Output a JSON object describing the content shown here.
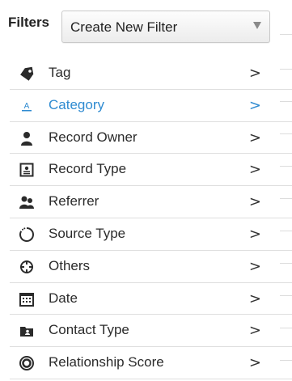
{
  "header": {
    "title": "Filters",
    "select": {
      "value": "Create New Filter"
    }
  },
  "filters": [
    {
      "label": "Tag",
      "icon": "tag-icon",
      "chevron": ">"
    },
    {
      "label": "Category",
      "icon": "category-icon",
      "chevron": ">",
      "active": true
    },
    {
      "label": "Record Owner",
      "icon": "person-icon",
      "chevron": ">"
    },
    {
      "label": "Record Type",
      "icon": "id-card-icon",
      "chevron": ">"
    },
    {
      "label": "Referrer",
      "icon": "referrer-icon",
      "chevron": ">"
    },
    {
      "label": "Source Type",
      "icon": "spinner-icon",
      "chevron": ">"
    },
    {
      "label": "Others",
      "icon": "crosshair-icon",
      "chevron": ">"
    },
    {
      "label": "Date",
      "icon": "calendar-icon",
      "chevron": ">"
    },
    {
      "label": "Contact Type",
      "icon": "contact-folder-icon",
      "chevron": ">"
    },
    {
      "label": "Relationship Score",
      "icon": "ring-icon",
      "chevron": ">"
    }
  ],
  "colors": {
    "active": "#2f8bd1",
    "text": "#2b2b2b",
    "divider": "#dedede"
  }
}
